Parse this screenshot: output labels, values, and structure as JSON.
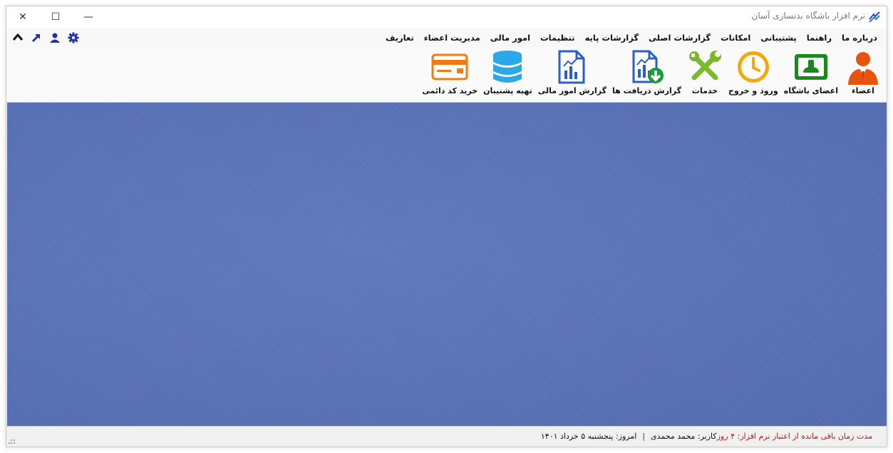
{
  "window": {
    "title": "نرم افزار باشگاه بدنسازی آسان",
    "minimize_glyph": "—",
    "maximize_glyph": "☐",
    "close_glyph": "✕"
  },
  "menu": {
    "items": [
      {
        "label": "تعاریف"
      },
      {
        "label": "مدیریت اعضاء"
      },
      {
        "label": "امور مالی"
      },
      {
        "label": "تنظیمات"
      },
      {
        "label": "گزارشات پایه"
      },
      {
        "label": "گزارشات اصلی"
      },
      {
        "label": "امکانات"
      },
      {
        "label": "پشتیبانی"
      },
      {
        "label": "راهنما"
      },
      {
        "label": "درباره ما"
      }
    ],
    "quick_icons": [
      "chevron-up-icon",
      "external-link-arrow-icon",
      "user-icon",
      "gear-icon"
    ]
  },
  "ribbon": {
    "buttons": [
      {
        "label": "اعضاء",
        "icon": "person-icon"
      },
      {
        "label": "اعضای باشگاه",
        "icon": "member-card-icon"
      },
      {
        "label": "ورود و خروج",
        "icon": "clock-icon"
      },
      {
        "label": "خدمات",
        "icon": "tools-icon"
      },
      {
        "label": "گزارش دریافت ها",
        "icon": "report-download-icon"
      },
      {
        "label": "گزارش امور مالی",
        "icon": "report-chart-icon"
      },
      {
        "label": "تهیه پشتیبان",
        "icon": "database-icon"
      },
      {
        "label": "خرید کد دائمی",
        "icon": "credit-card-icon"
      }
    ]
  },
  "status": {
    "date": "امروز: پنجشنبه ۵ خرداد ۱۴۰۱",
    "separator": "|",
    "user": "کاربر: محمد محمدی",
    "license_warning": "مدت زمان باقی مانده از اعتبار نرم افزار: ۴ روز"
  },
  "colors": {
    "workspace": "#5a72b8",
    "accent_blue": "#1d2fb0",
    "warning_red": "#d01010",
    "orange": "#f07a14",
    "green": "#1a9a1a"
  }
}
